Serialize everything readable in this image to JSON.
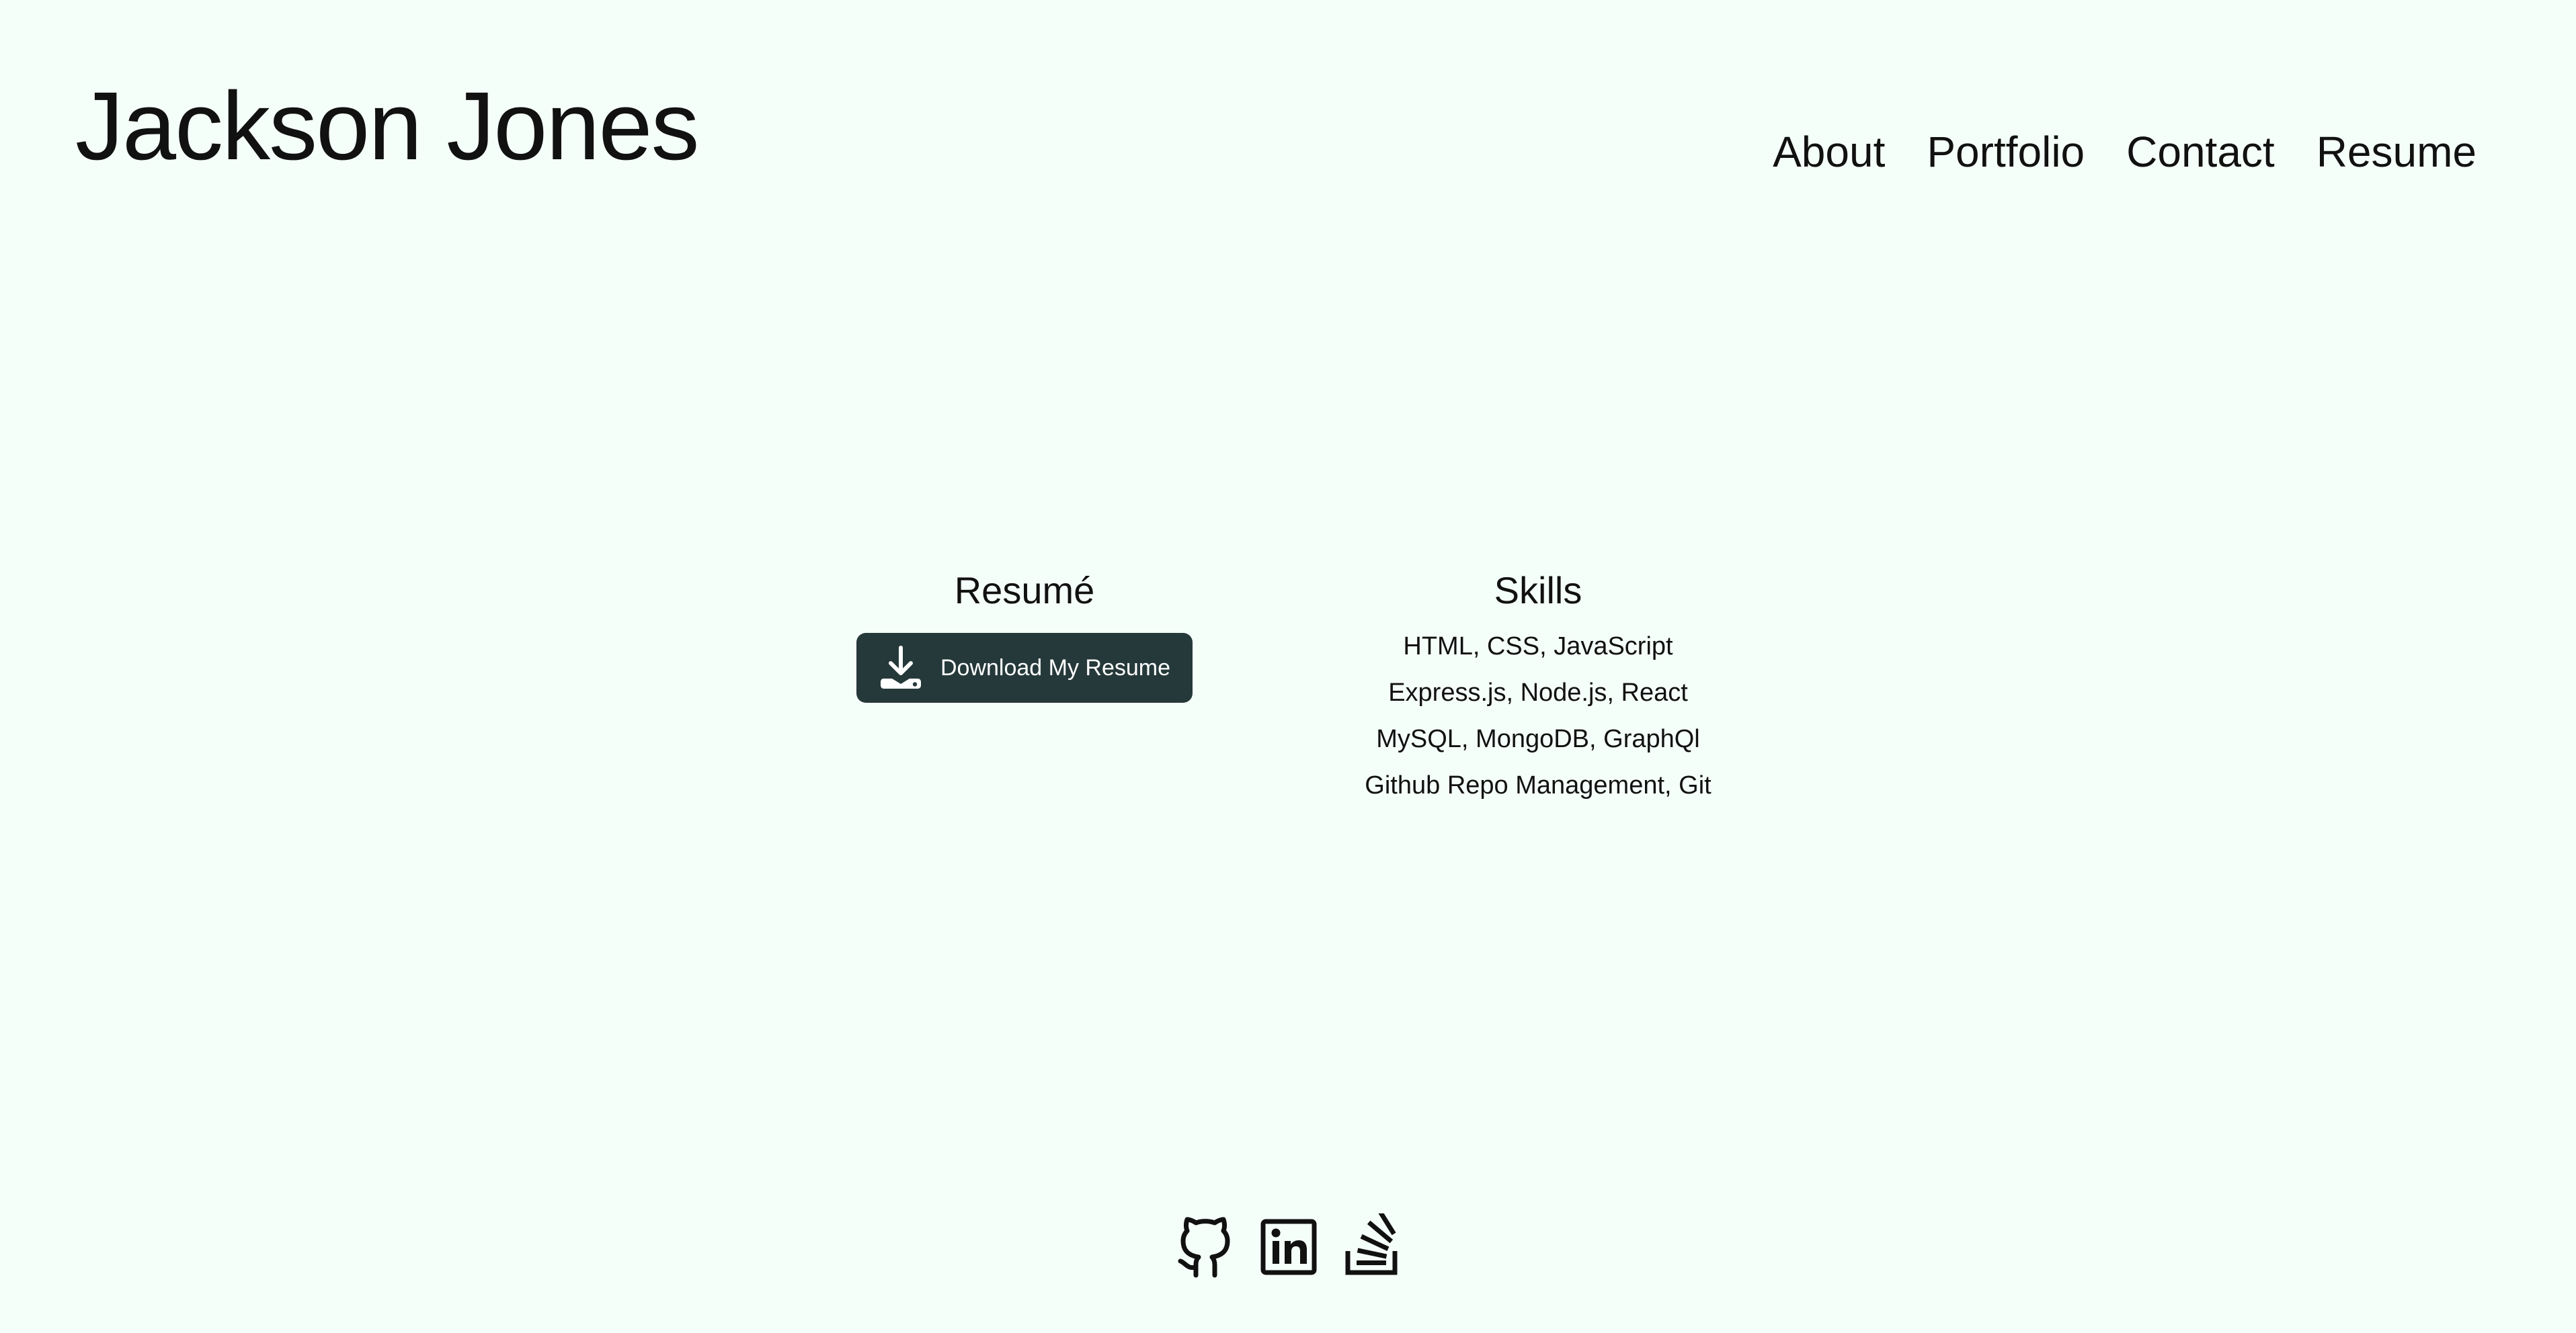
{
  "header": {
    "site_title": "Jackson Jones",
    "nav": [
      {
        "label": "About"
      },
      {
        "label": "Portfolio"
      },
      {
        "label": "Contact"
      },
      {
        "label": "Resume"
      }
    ]
  },
  "resume": {
    "heading": "Resumé",
    "button_label": "Download My Resume",
    "button_icon": "download-icon"
  },
  "skills": {
    "heading": "Skills",
    "items": [
      "HTML, CSS, JavaScript",
      "Express.js, Node.js, React",
      "MySQL, MongoDB, GraphQl",
      "Github Repo Management, Git"
    ]
  },
  "footer": {
    "socials": [
      {
        "icon": "github-icon"
      },
      {
        "icon": "linkedin-icon"
      },
      {
        "icon": "stackoverflow-icon"
      }
    ]
  },
  "colors": {
    "background": "#f5fff9",
    "text": "#111111",
    "button_background": "#26393a",
    "button_text": "#ffffff"
  }
}
